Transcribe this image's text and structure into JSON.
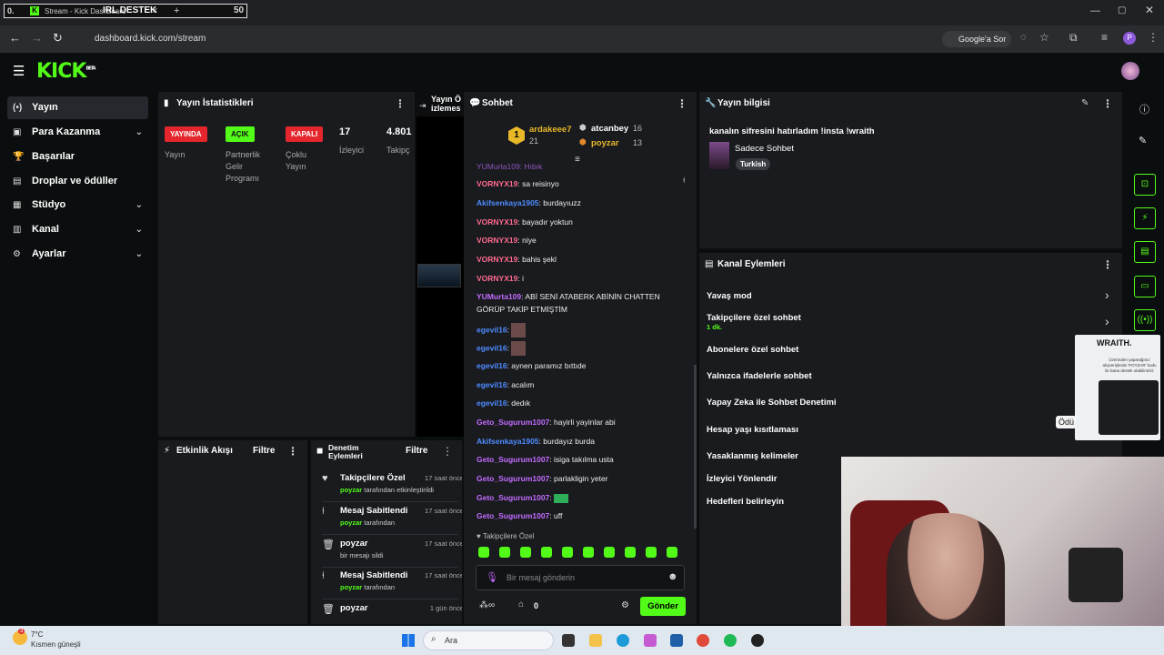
{
  "browser": {
    "tab_overlay_left": "0.",
    "tab_title": "Stream - Kick Dashboard",
    "overlay_title": "IRL DESTEK",
    "overlay_count": "50",
    "tab_close": "×",
    "new_tab": "+",
    "url": "dashboard.kick.com/stream",
    "google_button": "Google'a Sor",
    "profile_initial": "P"
  },
  "nav": {
    "items": [
      {
        "label": "Yayın",
        "icon": "(•)"
      },
      {
        "label": "Para Kazanma",
        "icon": "▣"
      },
      {
        "label": "Başarılar",
        "icon": "🏆"
      },
      {
        "label": "Droplar ve ödüller",
        "icon": "▤"
      },
      {
        "label": "Stüdyo",
        "icon": "▦"
      },
      {
        "label": "Kanal",
        "icon": "▥"
      },
      {
        "label": "Ayarlar",
        "icon": "⚙"
      }
    ]
  },
  "stats": {
    "title": "Yayın İstatistikleri",
    "badges": [
      {
        "label": "YAYINDA",
        "caption": [
          "Yayın"
        ]
      },
      {
        "label": "AÇIK",
        "caption": [
          "Partnerlik",
          "Gelir",
          "Programı"
        ]
      },
      {
        "label": "KAPALI",
        "caption": [
          "Çoklu",
          "Yayın"
        ]
      }
    ],
    "viewers_value": "17",
    "viewers_label": "İzleyici",
    "followers_value": "4.801",
    "followers_label": "Takipç"
  },
  "preview": {
    "title_line1": "Yayın Ö",
    "title_line2": "izlemes"
  },
  "activity": {
    "title": "Etkinlik Akışı",
    "filter": "Filtre"
  },
  "mod": {
    "title_line1": "Denetim",
    "title_line2": "Eylemleri",
    "filter": "Filtre",
    "items": [
      {
        "title": "Takipçilere Özel",
        "time": "17 saat önce",
        "user": "poyzar",
        "rest": " tarafından etkinleştirildi"
      },
      {
        "title": "Mesaj Sabitlendi",
        "time": "17 saat önce",
        "user": "poyzar",
        "rest": " tarafından"
      },
      {
        "title": "poyzar",
        "time": "17 saat önce",
        "user": "",
        "rest": "bir mesajı sildi"
      },
      {
        "title": "Mesaj Sabitlendi",
        "time": "17 saat önce",
        "user": "poyzar",
        "rest": " tarafından"
      },
      {
        "title": "poyzar",
        "time": "1 gün önce",
        "user": "",
        "rest": ""
      }
    ]
  },
  "chat": {
    "title": "Sohbet",
    "top": [
      {
        "rank": "1",
        "name": "ardakeee7",
        "count": "21"
      },
      {
        "rank": "",
        "name": "atcanbey",
        "count": "16"
      },
      {
        "rank": "",
        "name": "poyzar",
        "count": "13"
      }
    ],
    "messages": [
      {
        "user": "VORNYX19",
        "color": "#ff6a8e",
        "text": "sa reisinyo"
      },
      {
        "user": "Akifsenkaya1905",
        "color": "#4f8cff",
        "text": "burdayıuzz"
      },
      {
        "user": "VORNYX19",
        "color": "#ff6a8e",
        "text": "bayadır yoktun"
      },
      {
        "user": "VORNYX19",
        "color": "#ff6a8e",
        "text": "niye"
      },
      {
        "user": "VORNYX19",
        "color": "#ff6a8e",
        "text": "bahis şekl"
      },
      {
        "user": "VORNYX19",
        "color": "#ff6a8e",
        "text": "i"
      },
      {
        "user": "YUMurta109",
        "color": "#c36bff",
        "text": "ABİ SENİ ATABERK ABİNİN CHATTEN"
      },
      {
        "user": "",
        "color": "#eee",
        "text": "GÖRÜP TAKİP ETMİŞTİM"
      },
      {
        "user": "egevil16",
        "color": "#4f8cff",
        "text": ""
      },
      {
        "user": "egevil16",
        "color": "#4f8cff",
        "text": ""
      },
      {
        "user": "egevil16",
        "color": "#4f8cff",
        "text": "aynen paramız bıttıde"
      },
      {
        "user": "egevil16",
        "color": "#4f8cff",
        "text": "acalım"
      },
      {
        "user": "egevil16",
        "color": "#4f8cff",
        "text": "dedık"
      },
      {
        "user": "Geto_Sugurum1007",
        "color": "#c36bff",
        "text": "hayirli yayinlar abi"
      },
      {
        "user": "Akifsenkaya1905",
        "color": "#4f8cff",
        "text": "burdayız burda"
      },
      {
        "user": "Geto_Sugurum1007",
        "color": "#c36bff",
        "text": "isiga takılma usta"
      },
      {
        "user": "Geto_Sugurum1007",
        "color": "#c36bff",
        "text": "parlakligin yeter"
      },
      {
        "user": "Geto_Sugurum1007",
        "color": "#c36bff",
        "text": ""
      },
      {
        "user": "Geto_Sugurum1007",
        "color": "#c36bff",
        "text": "uff"
      }
    ],
    "cut_line": "YUMurta109: Hıbık",
    "followers_only": "Takipçilere Özel",
    "placeholder": "Bir mesaj gönderin",
    "points": "0",
    "send": "Gönder"
  },
  "info": {
    "title": "Yayın bilgisi",
    "stream_title": "kanalın sifresini hatırladım !insta !wraith",
    "category": "Sadece Sohbet",
    "tag": "Turkish"
  },
  "actions": {
    "title": "Kanal Eylemleri",
    "items": [
      "Yavaş mod",
      "Takipçilere özel sohbet",
      "Abonelere özel sohbet",
      "Yalnızca ifadelerle sohbet",
      "Yapay Zeka ile Sohbet Denetimi",
      "Hesap yaşı kısıtlaması",
      "Yasaklanmış kelimeler",
      "İzleyici Yönlendir",
      "Hedefleri belirleyin"
    ],
    "follower_sub": "1 dk."
  },
  "ad": {
    "brand": "WRAITH.",
    "text": "Üzerinden yaparağınız alışverişlerde 'POYZAR' kodu ile bana destek olabilirsiniz",
    "peek": "Ödü"
  },
  "taskbar": {
    "temp": "7°C",
    "weather": "Kısmen güneşli",
    "search": "Ara",
    "notif": "3"
  }
}
